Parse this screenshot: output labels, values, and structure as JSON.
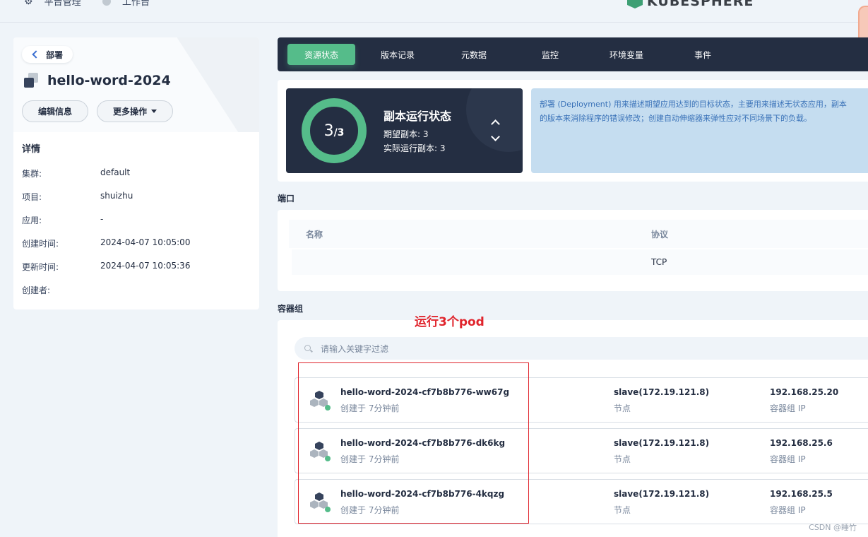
{
  "topnav": {
    "platform_label": "平台管理",
    "workbench_label": "工作台"
  },
  "brand": {
    "logo_text": "KUBESPHERE"
  },
  "left": {
    "back_label": "部署",
    "title": "hello-word-2024",
    "edit_btn": "编辑信息",
    "more_btn": "更多操作",
    "details_title": "详情",
    "details": [
      {
        "key": "集群:",
        "value": "default"
      },
      {
        "key": "项目:",
        "value": "shuizhu"
      },
      {
        "key": "应用:",
        "value": "-"
      },
      {
        "key": "创建时间:",
        "value": "2024-04-07 10:05:00"
      },
      {
        "key": "更新时间:",
        "value": "2024-04-07 10:05:36"
      },
      {
        "key": "创建者:",
        "value": ""
      }
    ]
  },
  "tabs": [
    "资源状态",
    "版本记录",
    "元数据",
    "监控",
    "环境变量",
    "事件"
  ],
  "active_tab": "资源状态",
  "replica": {
    "running": "3",
    "desired_fraction": "/3",
    "title": "副本运行状态",
    "desired_label": "期望副本: 3",
    "actual_label": "实际运行副本: 3"
  },
  "info": {
    "line1": "部署 (Deployment) 用来描述期望应用达到的目标状态，主要用来描述无状态应用，副本",
    "line2": "的版本来消除程序的错误修改；创建自动伸缩器来弹性应对不同场景下的负载。"
  },
  "ports": {
    "section_title": "端口",
    "col_name": "名称",
    "col_protocol": "协议",
    "row": {
      "name": "",
      "protocol": "TCP"
    }
  },
  "pods": {
    "section_title": "容器组",
    "search_placeholder": "请输入关键字过滤",
    "items": [
      {
        "name": "hello-word-2024-cf7b8b776-ww67g",
        "created": "创建于 7分钟前",
        "node": "slave(172.19.121.8)",
        "node_label": "节点",
        "ip": "192.168.25.20",
        "ip_label": "容器组 IP"
      },
      {
        "name": "hello-word-2024-cf7b8b776-dk6kg",
        "created": "创建于 7分钟前",
        "node": "slave(172.19.121.8)",
        "node_label": "节点",
        "ip": "192.168.25.6",
        "ip_label": "容器组 IP"
      },
      {
        "name": "hello-word-2024-cf7b8b776-4kqzg",
        "created": "创建于 7分钟前",
        "node": "slave(172.19.121.8)",
        "node_label": "节点",
        "ip": "192.168.25.5",
        "ip_label": "容器组 IP"
      }
    ]
  },
  "annotation": "运行3个pod",
  "watermark": "CSDN @睡竹",
  "colors": {
    "accent": "#55bc8a",
    "dark": "#242e42",
    "annotation": "#e0242c",
    "info_bg": "#c5ddf0"
  }
}
